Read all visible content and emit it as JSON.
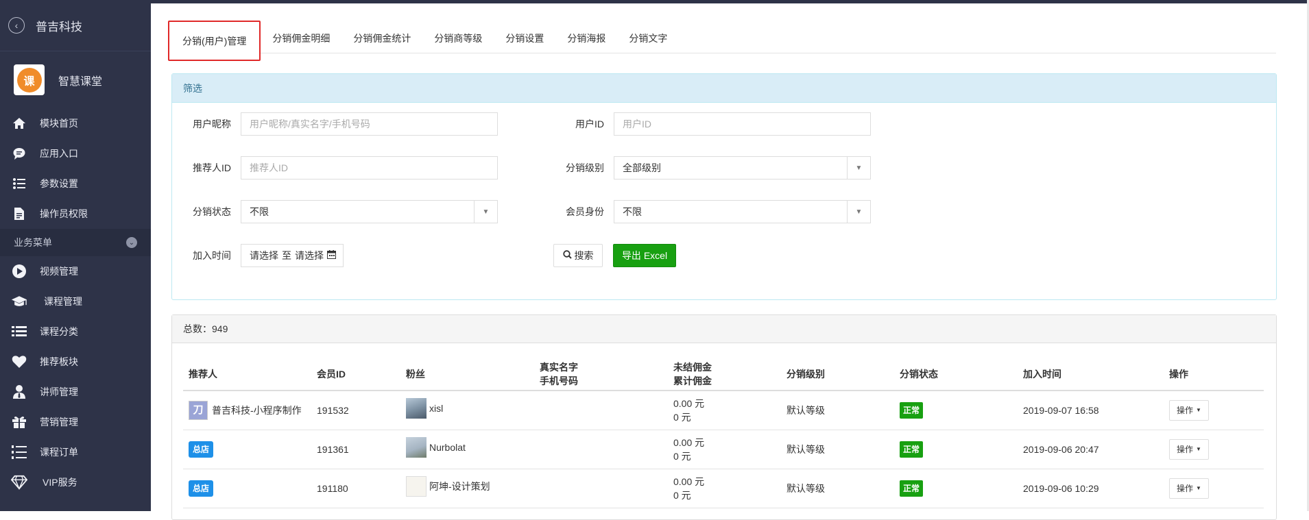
{
  "sidebar": {
    "company": "普吉科技",
    "app_name": "智慧课堂",
    "items": [
      {
        "label": "模块首页",
        "icon": "home-icon"
      },
      {
        "label": "应用入口",
        "icon": "chat-icon"
      },
      {
        "label": "参数设置",
        "icon": "list-settings-icon"
      },
      {
        "label": "操作员权限",
        "icon": "document-icon"
      }
    ],
    "group_label": "业务菜单",
    "group_items": [
      {
        "label": "视频管理",
        "icon": "play-icon"
      },
      {
        "label": "课程管理",
        "icon": "graduation-cap-icon"
      },
      {
        "label": "课程分类",
        "icon": "list-icon"
      },
      {
        "label": "推荐板块",
        "icon": "heart-icon"
      },
      {
        "label": "讲师管理",
        "icon": "user-tie-icon"
      },
      {
        "label": "营销管理",
        "icon": "gift-icon"
      },
      {
        "label": "课程订单",
        "icon": "ordered-list-icon"
      },
      {
        "label": "VIP服务",
        "icon": "diamond-icon"
      }
    ]
  },
  "tabs": [
    "分销(用户)管理",
    "分销佣金明细",
    "分销佣金统计",
    "分销商等级",
    "分销设置",
    "分销海报",
    "分销文字"
  ],
  "filter": {
    "title": "筛选",
    "nickname_label": "用户昵称",
    "nickname_placeholder": "用户昵称/真实名字/手机号码",
    "userid_label": "用户ID",
    "userid_placeholder": "用户ID",
    "referrer_label": "推荐人ID",
    "referrer_placeholder": "推荐人ID",
    "level_label": "分销级别",
    "level_value": "全部级别",
    "status_label": "分销状态",
    "status_value": "不限",
    "member_label": "会员身份",
    "member_value": "不限",
    "jointime_label": "加入时间",
    "date_start": "请选择",
    "date_sep": "至",
    "date_end": "请选择",
    "search_label": "搜索",
    "export_label": "导出 Excel"
  },
  "list": {
    "total_label": "总数：",
    "total": "949",
    "headers": {
      "referrer": "推荐人",
      "member_id": "会员ID",
      "fans": "粉丝",
      "realname": "真实名字",
      "phone": "手机号码",
      "unsettled": "未结佣金",
      "total_comm": "累计佣金",
      "level": "分销级别",
      "status": "分销状态",
      "join_time": "加入时间",
      "action": "操作"
    },
    "rows": [
      {
        "referrer": "普吉科技-小程序制作",
        "member_id": "191532",
        "fan": "xisl",
        "unsettled": "0.00 元",
        "total": "0 元",
        "level": "默认等级",
        "status": "正常",
        "join_time": "2019-09-07 16:58",
        "action": "操作"
      },
      {
        "referrer": "总店",
        "member_id": "191361",
        "fan": "Nurbolat",
        "unsettled": "0.00 元",
        "total": "0 元",
        "level": "默认等级",
        "status": "正常",
        "join_time": "2019-09-06 20:47",
        "action": "操作"
      },
      {
        "referrer": "总店",
        "member_id": "191180",
        "fan": "阿坤-设计策划",
        "unsettled": "0.00 元",
        "total": "0 元",
        "level": "默认等级",
        "status": "正常",
        "join_time": "2019-09-06 10:29",
        "action": "操作"
      }
    ]
  },
  "colors": {
    "sidebar_bg": "#2e3348",
    "active_tab_border": "#e02828",
    "export_green": "#18a011",
    "badge_blue": "#1e90e8"
  }
}
